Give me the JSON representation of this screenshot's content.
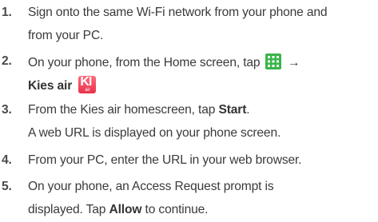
{
  "steps": [
    {
      "number": "1.",
      "line1": "Sign onto the same Wi-Fi network from your phone and",
      "line2": "from your PC."
    },
    {
      "number": "2.",
      "line1_prefix": "On your phone, from the Home screen, tap",
      "arrow": "→",
      "line2_bold": "Kies air",
      "apps_icon": "apps-grid-icon",
      "kies_icon": "kies-air-icon",
      "kies_icon_text": "KI",
      "kies_icon_subtext": "air",
      "apps_icon_color": "#3ab54a",
      "kies_icon_color": "#e8324a"
    },
    {
      "number": "3.",
      "line1_prefix": "From the Kies air homescreen, tap",
      "line1_bold": "Start",
      "line1_suffix": ".",
      "line2": "A web URL is displayed on your phone screen."
    },
    {
      "number": "4.",
      "line1": "From your PC, enter the URL in your web browser."
    },
    {
      "number": "5.",
      "line1": "On your phone, an Access Request prompt is",
      "line2_prefix": "displayed. Tap",
      "line2_bold": "Allow",
      "line2_suffix": "to continue."
    }
  ]
}
